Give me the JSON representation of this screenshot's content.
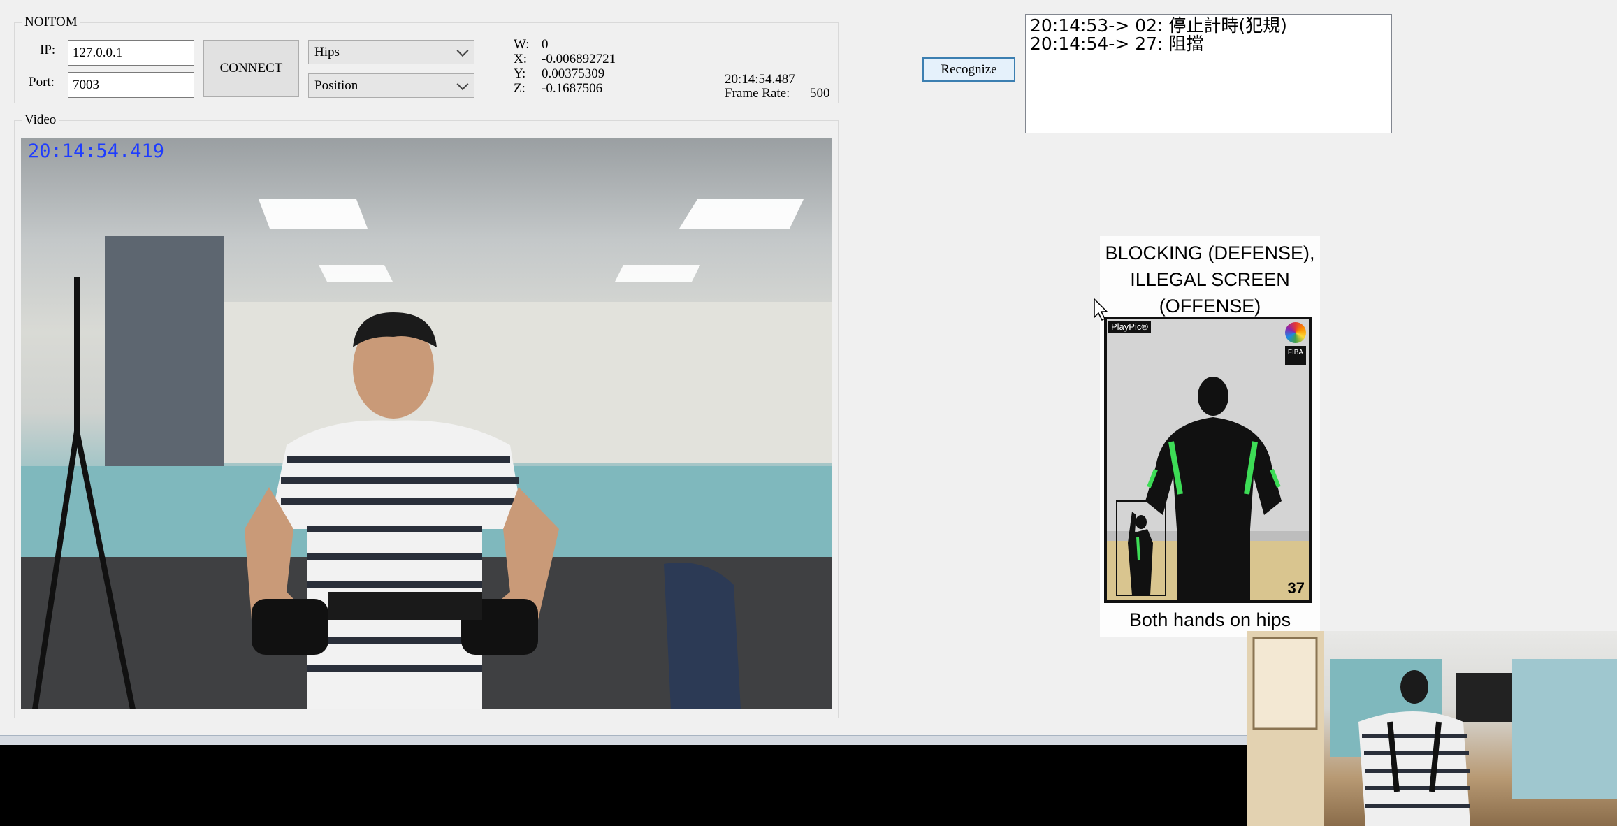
{
  "window": {
    "title": "NOITOM"
  },
  "connection": {
    "ip_label": "IP:",
    "ip_value": "127.0.0.1",
    "port_label": "Port:",
    "port_value": "7003",
    "connect_label": "CONNECT",
    "joint_selected": "Hips",
    "mode_selected": "Position"
  },
  "quaternion": {
    "w_label": "W:",
    "w_value": "0",
    "x_label": "X:",
    "x_value": "-0.006892721",
    "y_label": "Y:",
    "y_value": "0.00375309",
    "z_label": "Z:",
    "z_value": "-0.1687506"
  },
  "status": {
    "time": "20:14:54.487",
    "frame_rate_label": "Frame Rate:",
    "frame_rate_value": "500"
  },
  "video": {
    "group_label": "Video",
    "timestamp": "20:14:54.419"
  },
  "recognize_label": "Recognize",
  "log_lines": [
    "20:14:53-> 02: 停止計時(犯規)",
    "20:14:54-> 27: 阻擋"
  ],
  "signal_card": {
    "title_line1": "BLOCKING (DEFENSE),",
    "title_line2": "ILLEGAL SCREEN",
    "title_line3": "(OFFENSE)",
    "brand": "PlayPic®",
    "org_badge": "FIBA",
    "number": "37",
    "caption": "Both hands on hips"
  },
  "colors": {
    "accent_button_border": "#3c7fb1",
    "timestamp_blue": "#1e3cff",
    "jersey_green": "#3ddc56"
  }
}
